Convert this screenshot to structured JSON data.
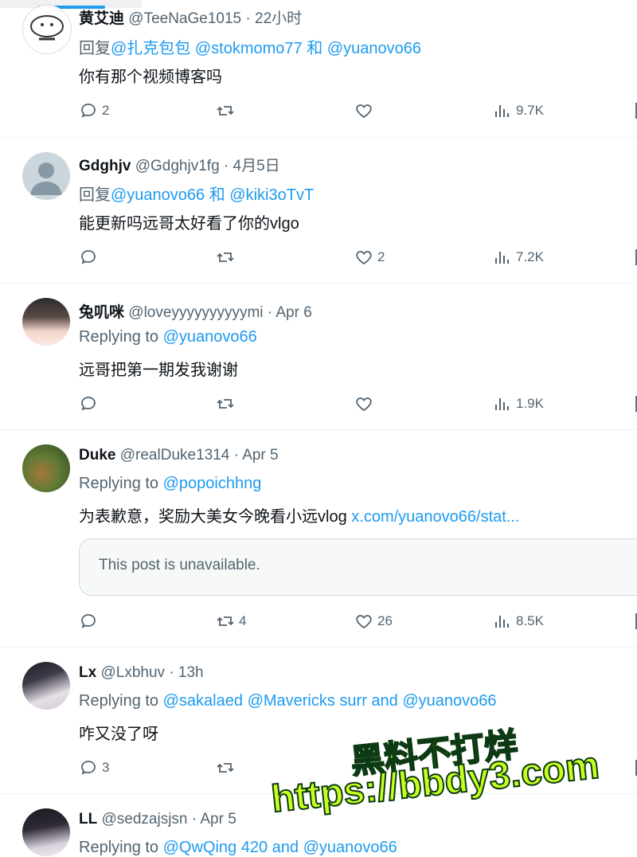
{
  "tweets": [
    {
      "name": "黄艾迪",
      "handle": "@TeeNaGe1015",
      "time": "22小时",
      "reply_prefix": "回复",
      "mentions": [
        "@扎克包包",
        "@stokmomo77",
        "和",
        "@yuanovo66"
      ],
      "text": "你有那个视频博客吗",
      "stats": {
        "replies": "2",
        "retweets": "",
        "likes": "",
        "views": "9.7K"
      }
    },
    {
      "name": "Gdghjv",
      "handle": "@Gdghjv1fg",
      "time": "4月5日",
      "reply_prefix": "回复",
      "mentions": [
        "@yuanovo66",
        "和",
        "@kiki3oTvT"
      ],
      "text": "能更新吗远哥太好看了你的vlgo",
      "stats": {
        "replies": "",
        "retweets": "",
        "likes": "2",
        "views": "7.2K"
      }
    },
    {
      "name": "兔叽咪",
      "handle": "@loveyyyyyyyyyymi",
      "time": "Apr 6",
      "reply_prefix": "Replying to",
      "mentions": [
        "@yuanovo66"
      ],
      "text": "远哥把第一期发我谢谢",
      "stats": {
        "replies": "",
        "retweets": "",
        "likes": "",
        "views": "1.9K"
      }
    },
    {
      "name": "Duke",
      "handle": "@realDuke1314",
      "time": "Apr 5",
      "reply_prefix": "Replying to",
      "mentions": [
        "@popoichhng"
      ],
      "text": "为表歉意，奖励大美女今晚看小远vlog",
      "link": "x.com/yuanovo66/stat...",
      "quote": "This post is unavailable.",
      "stats": {
        "replies": "",
        "retweets": "4",
        "likes": "26",
        "views": "8.5K"
      }
    },
    {
      "name": "Lx",
      "handle": "@Lxbhuv",
      "time": "13h",
      "reply_prefix": "Replying to",
      "mentions": [
        "@sakalaed",
        "@Mavericks surr",
        "and",
        "@yuanovo66"
      ],
      "text": "咋又没了呀",
      "stats": {
        "replies": "3",
        "retweets": "",
        "likes": "",
        "views": ""
      }
    },
    {
      "name": "LL",
      "handle": "@sedzajsjsn",
      "time": "Apr 5",
      "reply_prefix": "Replying to",
      "mentions": [
        "@QwQing 420",
        "and",
        "@yuanovo66"
      ]
    }
  ],
  "watermark": {
    "line1": "黑料不打烊",
    "line2": "https://bbdy3.com"
  },
  "colors": {
    "accent": "#1d9bf0",
    "muted": "#536471",
    "watermark": "#c8ff1e"
  },
  "icons": [
    "reply-icon",
    "retweet-icon",
    "like-icon",
    "views-icon",
    "bookmark-icon"
  ]
}
